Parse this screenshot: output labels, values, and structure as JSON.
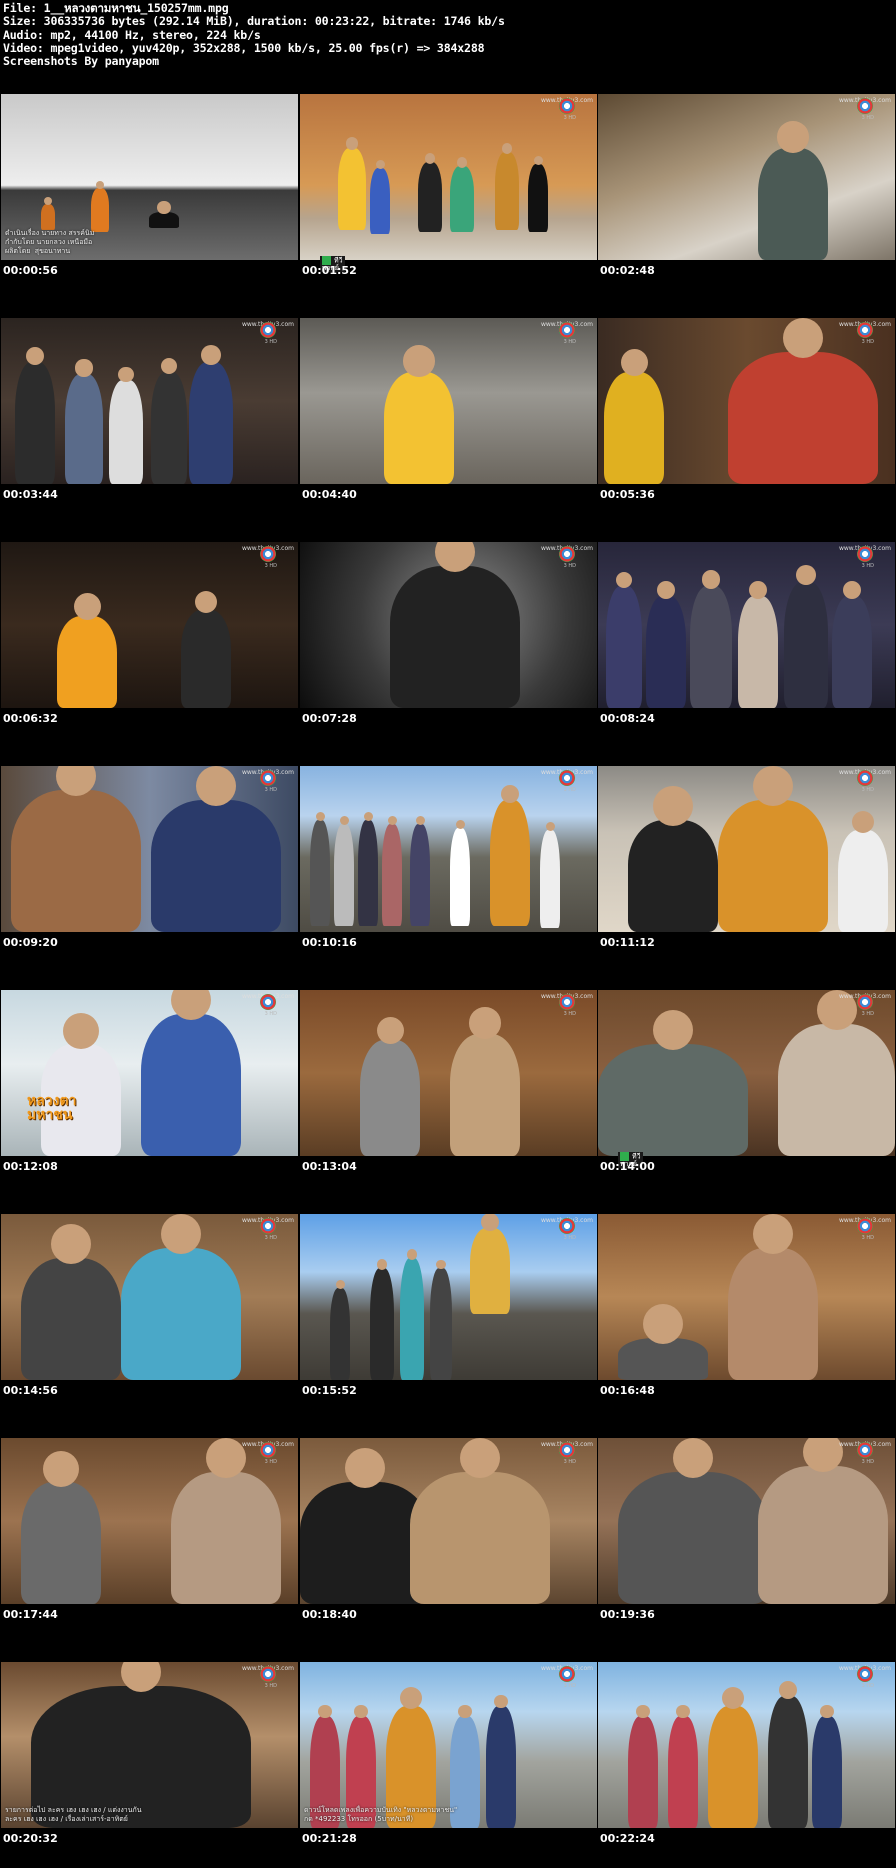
{
  "header": {
    "lines": [
      "File: 1__หลวงตามหาชน_150257mm.mpg",
      "Size: 306335736 bytes (292.14 MiB), duration: 00:23:22, bitrate: 1746 kb/s",
      "Audio: mp2, 44100 Hz, stereo, 224 kb/s",
      "Video: mpeg1video, yuv420p, 352x288, 1500 kb/s, 25.00 fps(r) => 384x288",
      "Screenshots By panyapom"
    ]
  },
  "watermark": {
    "url": "www.thaitv3.com",
    "sub": "3 HD"
  },
  "overlays": {
    "caption_f1": "ดำเนินเรื่อง นายทาง สรรค์นิม\nกำกับโดย นายกลวง เหนือมือ\nผลิตโดย  สุขอนาทาน",
    "channel_badge": "ทีวี\nพากย์",
    "show_logo": "หลวงตา\nมหาชน",
    "caption_f22": "รายการต่อไป ละคร เฮง เฮง เฮง / แต่งงานกัน\nละคร เฮง เฮง เฮง / เรื่องเล่าเสาร์-อาทิตย์",
    "caption_f23": "ดาวน์โหลดเพลงเพื่อความบันเทิง \"หลวงตามหาชน\"\nกด *492233 โทรออก (5บาท/นาที)"
  },
  "frames": [
    {
      "ts": "00:00:56",
      "bg": "linear-gradient(180deg,#c9c9c9 0%,#eeeeee 55%,#3a3a3a 58%,#6d6d6d 100%)",
      "caption": true
    },
    {
      "ts": "00:01:52",
      "bg": "linear-gradient(180deg,#b8743f 0%,#d79a55 55%,#b6a48e 75%,#d8d2c6 100%)",
      "badge": true
    },
    {
      "ts": "00:02:48",
      "bg": "linear-gradient(160deg,#5d4a33 0%,#a89478 40%,#d8d2c8 70%,#7d7467 100%)"
    },
    {
      "ts": "00:03:44",
      "bg": "linear-gradient(180deg,#2b2420 0%,#4a3c33 50%,#2a2220 100%)"
    },
    {
      "ts": "00:04:40",
      "bg": "linear-gradient(180deg,#5c5a55 0%,#9a9892 45%,#6a655d 100%)"
    },
    {
      "ts": "00:05:36",
      "bg": "linear-gradient(90deg,#3a2b22 0%,#6a4a2f 50%,#4a3020 100%)"
    },
    {
      "ts": "00:06:32",
      "bg": "linear-gradient(180deg,#1f1813 0%,#3a2a1e 50%,#1d1510 100%)"
    },
    {
      "ts": "00:07:28",
      "bg": "radial-gradient(circle at 55% 45%,#8e8e8e 0%,#3a3a3a 55%,#0c0c0c 100%)"
    },
    {
      "ts": "00:08:24",
      "bg": "linear-gradient(180deg,#27263a 0%,#3c3b55 50%,#201f2e 100%)"
    },
    {
      "ts": "00:09:20",
      "bg": "linear-gradient(90deg,#5a4a3c 0%,#7d8aa2 50%,#3d4a63 100%)"
    },
    {
      "ts": "00:10:16",
      "bg": "linear-gradient(180deg,#88b3e0 0%,#b9d3ee 30%,#6b6a60 55%,#4f4c44 100%)"
    },
    {
      "ts": "00:11:12",
      "bg": "linear-gradient(180deg,#8c8a85 0%,#c9c2b6 40%,#e0d7c8 100%)"
    },
    {
      "ts": "00:12:08",
      "bg": "linear-gradient(180deg,#c7d8e0 0%,#e8eef0 45%,#a9b4b8 100%)",
      "showlogo": true
    },
    {
      "ts": "00:13:04",
      "bg": "linear-gradient(180deg,#7a4a28 0%,#9b6a3e 50%,#5a3d24 100%)"
    },
    {
      "ts": "00:14:00",
      "bg": "linear-gradient(180deg,#6e4a2c 0%,#8a6040 50%,#4a3322 100%)",
      "badge": true
    },
    {
      "ts": "00:14:56",
      "bg": "linear-gradient(180deg,#7a5a3c 0%,#a27c56 50%,#6a4a30 100%)"
    },
    {
      "ts": "00:15:52",
      "bg": "linear-gradient(180deg,#5ea0e6 0%,#a9cdf0 35%,#5a5750 60%,#3e3b35 100%)"
    },
    {
      "ts": "00:16:48",
      "bg": "linear-gradient(180deg,#8a5a34 0%,#b78756 50%,#6d4a2e 100%)"
    },
    {
      "ts": "00:17:44",
      "bg": "linear-gradient(180deg,#6b4a2e 0%,#9c7350 50%,#5a3f28 100%)"
    },
    {
      "ts": "00:18:40",
      "bg": "linear-gradient(180deg,#7b5a3c 0%,#a88562 50%,#5c4530 100%)"
    },
    {
      "ts": "00:19:36",
      "bg": "linear-gradient(180deg,#6e5038 0%,#957257 50%,#4d3a29 100%)"
    },
    {
      "ts": "00:20:32",
      "bg": "linear-gradient(180deg,#6a4a30 0%,#b48f6a 45%,#5a4330 100%)",
      "caption22": true
    },
    {
      "ts": "00:21:28",
      "bg": "linear-gradient(180deg,#7fb3e0 0%,#b7d6ef 30%,#a2a49e 60%,#7b7b74 100%)",
      "caption23": true
    },
    {
      "ts": "00:22:24",
      "bg": "linear-gradient(180deg,#7fb3e0 0%,#b7d6ef 30%,#a2a49e 60%,#7b7b74 100%)"
    }
  ]
}
